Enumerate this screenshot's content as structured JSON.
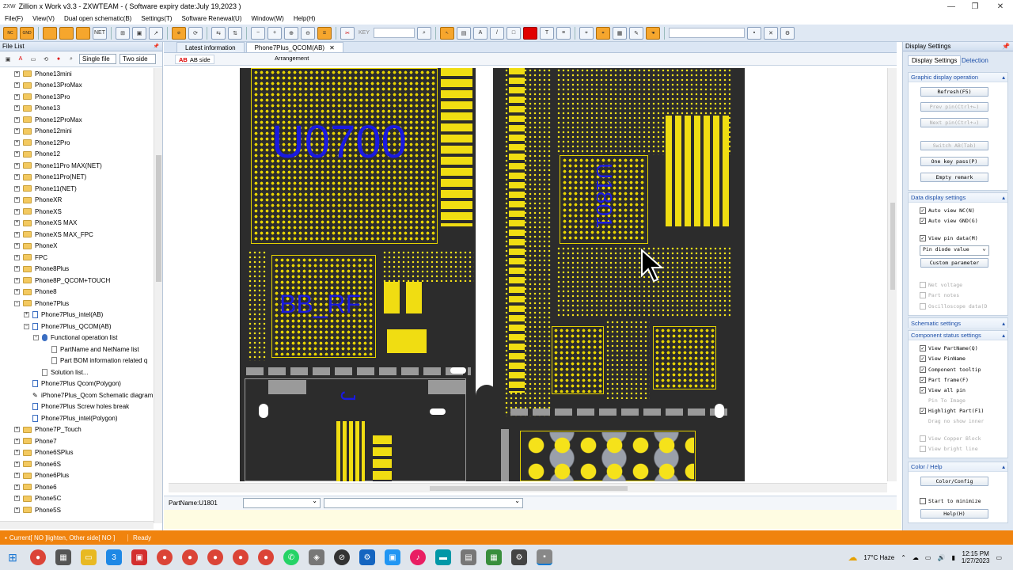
{
  "window": {
    "title": "Zillion x Work v3.3 - ZXWTEAM - ( Software expiry date:July 19,2023 )",
    "logo": "ZXW"
  },
  "menu": [
    "File(F)",
    "View(V)",
    "Dual open schematic(B)",
    "Settings(T)",
    "Software Renewal(U)",
    "Window(W)",
    "Help(H)"
  ],
  "toolbar": {
    "nc": "NC",
    "gnd": "GND",
    "net": "NET",
    "key": "KEY",
    "text_tool": "A",
    "font_tool": "T"
  },
  "left": {
    "title": "File List",
    "pin": "📌",
    "single": "Single file",
    "two": "Two side",
    "tree": [
      {
        "l": "Phone13mini",
        "d": 0,
        "t": "f",
        "e": "+"
      },
      {
        "l": "Phone13ProMax",
        "d": 0,
        "t": "f",
        "e": "+"
      },
      {
        "l": "Phone13Pro",
        "d": 0,
        "t": "f",
        "e": "+"
      },
      {
        "l": "Phone13",
        "d": 0,
        "t": "f",
        "e": "+"
      },
      {
        "l": "Phone12ProMax",
        "d": 0,
        "t": "f",
        "e": "+"
      },
      {
        "l": "Phone12mini",
        "d": 0,
        "t": "f",
        "e": "+"
      },
      {
        "l": "Phone12Pro",
        "d": 0,
        "t": "f",
        "e": "+"
      },
      {
        "l": "Phone12",
        "d": 0,
        "t": "f",
        "e": "+"
      },
      {
        "l": "Phone11Pro MAX(NET)",
        "d": 0,
        "t": "f",
        "e": "+"
      },
      {
        "l": "Phone11Pro(NET)",
        "d": 0,
        "t": "f",
        "e": "+"
      },
      {
        "l": "Phone11(NET)",
        "d": 0,
        "t": "f",
        "e": "+"
      },
      {
        "l": "PhoneXR",
        "d": 0,
        "t": "f",
        "e": "+"
      },
      {
        "l": "PhoneXS",
        "d": 0,
        "t": "f",
        "e": "+"
      },
      {
        "l": "PhoneXS MAX",
        "d": 0,
        "t": "f",
        "e": "+"
      },
      {
        "l": "PhoneXS MAX_FPC",
        "d": 0,
        "t": "f",
        "e": "+"
      },
      {
        "l": "PhoneX",
        "d": 0,
        "t": "f",
        "e": "+"
      },
      {
        "l": "FPC",
        "d": 0,
        "t": "f",
        "e": "+"
      },
      {
        "l": "Phone8Plus",
        "d": 0,
        "t": "f",
        "e": "+"
      },
      {
        "l": "Phone8P_QCOM+TOUCH",
        "d": 0,
        "t": "f",
        "e": "+"
      },
      {
        "l": "Phone8",
        "d": 0,
        "t": "f",
        "e": "+"
      },
      {
        "l": "Phone7Plus",
        "d": 0,
        "t": "f",
        "e": "-"
      },
      {
        "l": "Phone7Plus_intel(AB)",
        "d": 1,
        "t": "d",
        "e": "+"
      },
      {
        "l": "Phone7Plus_QCOM(AB)",
        "d": 1,
        "t": "d",
        "e": "-"
      },
      {
        "l": "Functional operation list",
        "d": 2,
        "t": "g",
        "e": "-"
      },
      {
        "l": "PartName and NetName list",
        "d": 3,
        "t": "t",
        "e": ""
      },
      {
        "l": "Part BOM information related q",
        "d": 3,
        "t": "t",
        "e": ""
      },
      {
        "l": "Solution list...",
        "d": 2,
        "t": "t",
        "e": ""
      },
      {
        "l": "Phone7Plus Qcom(Polygon)",
        "d": 1,
        "t": "d",
        "e": ""
      },
      {
        "l": "iPhone7Plus_Qcom Schematic diagram",
        "d": 1,
        "t": "s",
        "e": ""
      },
      {
        "l": "Phone7Plus Screw holes break",
        "d": 1,
        "t": "d",
        "e": ""
      },
      {
        "l": "Phone7Plus_intel(Polygon)",
        "d": 1,
        "t": "d",
        "e": ""
      },
      {
        "l": "Phone7P_Touch",
        "d": 0,
        "t": "f",
        "e": "+"
      },
      {
        "l": "Phone7",
        "d": 0,
        "t": "f",
        "e": "+"
      },
      {
        "l": "Phone6SPlus",
        "d": 0,
        "t": "f",
        "e": "+"
      },
      {
        "l": "Phone6S",
        "d": 0,
        "t": "f",
        "e": "+"
      },
      {
        "l": "Phone6Plus",
        "d": 0,
        "t": "f",
        "e": "+"
      },
      {
        "l": "Phone6",
        "d": 0,
        "t": "f",
        "e": "+"
      },
      {
        "l": "Phone5C",
        "d": 0,
        "t": "f",
        "e": "+"
      },
      {
        "l": "Phone5S",
        "d": 0,
        "t": "f",
        "e": "+"
      }
    ]
  },
  "tabs": {
    "t1": "Latest information",
    "t2": "Phone7Plus_QCOM(AB)",
    "close": "✕",
    "ab": "AB side",
    "arr": "Arrangement"
  },
  "board": {
    "u0700": "U0700",
    "bbrf": "BB_RF",
    "u1801": "U1801"
  },
  "partbar": {
    "label": "PartName:U1801"
  },
  "right": {
    "title": "Display Settings",
    "tab1": "Display Settings",
    "tab2": "Detection",
    "s1": "Graphic display operation",
    "refresh": "Refresh(F5)",
    "prev": "Prev pin(Ctrl+←)",
    "next": "Next pin(Ctrl+→)",
    "switch": "Switch AB(Tab)",
    "onekey": "One key pass(P)",
    "empty": "Empty remark",
    "s2": "Data display settings",
    "autonc": "Auto view NC(N)",
    "autognd": "Auto view GND(G)",
    "viewpin": "View pin data(M)",
    "diode": "Pin diode value",
    "custom": "Custom parameter",
    "netv": "Net voltage",
    "partnotes": "Part notes",
    "osc": "Oscilloscope data(D",
    "s3": "Schematic settings",
    "s4": "Component status settings",
    "vpart": "View PartName(Q)",
    "vpin": "View PinName",
    "tooltip": "Component tooltip",
    "frame": "Part frame(F)",
    "allpin": "View all pin",
    "pinimg": "Pin To Image",
    "highlight": "Highlight Part(F1)",
    "drag": "Drag no show inner",
    "copper": "View Copper Block",
    "bright": "View bright line",
    "s5": "Color / Help",
    "color": "Color/Config",
    "startmin": "Start to minimize",
    "help": "Help(H)"
  },
  "status": {
    "current": "Current[ NO ]lighten, Other side[ NO ]",
    "ready": "Ready"
  },
  "taskbar": {
    "weather": "17°C  Haze",
    "time": "12:15 PM",
    "date": "1/27/2023"
  },
  "colors": {
    "accent": "#f0830e",
    "board": "#2c2c2c",
    "copper": "#f0dd12",
    "label": "#1a1ae0"
  }
}
